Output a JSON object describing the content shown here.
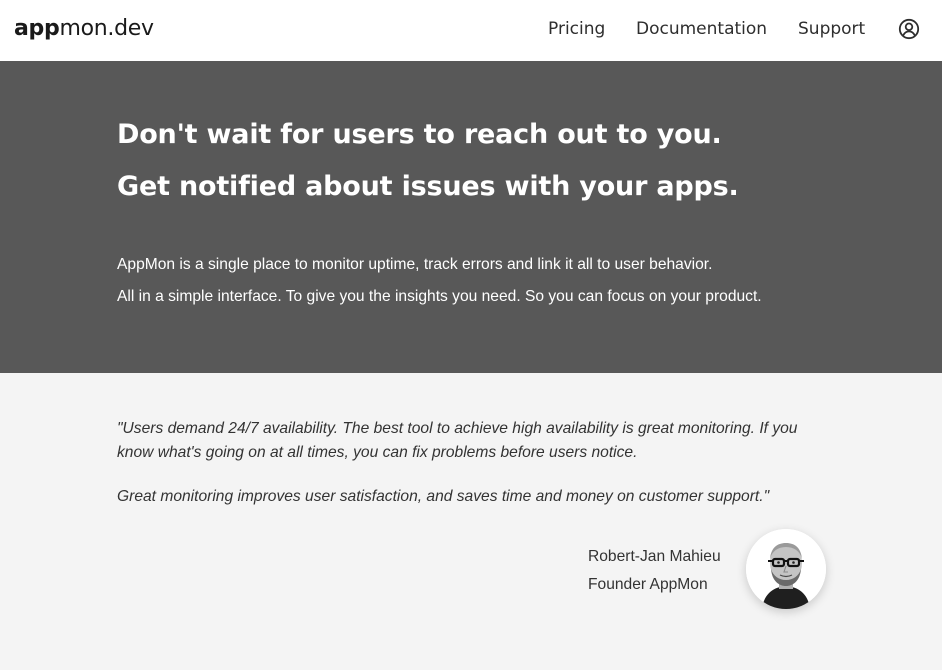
{
  "header": {
    "logo": {
      "bold": "app",
      "light": "mon.dev"
    },
    "nav": [
      {
        "label": "Pricing"
      },
      {
        "label": "Documentation"
      },
      {
        "label": "Support"
      }
    ],
    "account_icon": "user-circle-icon"
  },
  "hero": {
    "headline_1": "Don't wait for users to reach out to you.",
    "headline_2": "Get notified about issues with your apps.",
    "paragraph_1": "AppMon is a single place to monitor uptime, track errors and link it all to user behavior.",
    "paragraph_2": "All in a simple interface. To give you the insights you need. So you can focus on your product."
  },
  "testimonial": {
    "quote_1": "\"Users demand 24/7 availability. The best tool to achieve high availability is great monitoring. If you know what's going on at all times, you can fix problems before users notice.",
    "quote_2": "Great monitoring improves user satisfaction, and saves time and money on customer support.\"",
    "author_name": "Robert-Jan Mahieu",
    "author_role": "Founder AppMon",
    "avatar": "author-photo"
  },
  "colors": {
    "header_bg": "#ffffff",
    "hero_bg": "#585858",
    "page_bg": "#f4f4f4",
    "text_dark": "#2a2a2a"
  }
}
